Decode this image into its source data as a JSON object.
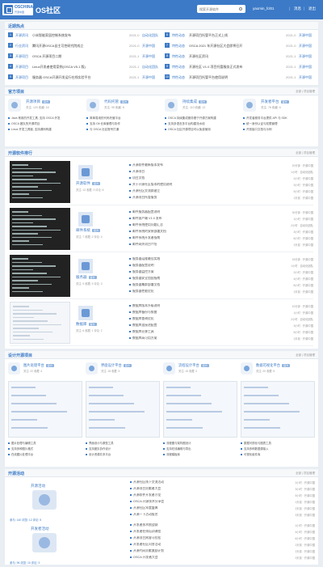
{
  "header": {
    "logo_top": "OSCHINA",
    "logo_sub": "开源中国",
    "site_title": "OS社区",
    "search_placeholder": "搜索开源软件",
    "user": "yaomin_fcl01",
    "link_msg": "消息",
    "link_logout": "退出",
    "sep": "|"
  },
  "news": {
    "title": "近期热点",
    "left": [
      {
        "n": "1",
        "cat": "开源资讯",
        "title": "小米智能家居控制系统发布",
        "date": "2021-0",
        "author": "自动化团队"
      },
      {
        "n": "2",
        "cat": "行业资讯",
        "title": "腾讯开源OSCA自主可控研究院成立",
        "date": "2021-0",
        "author": "开源中国"
      },
      {
        "n": "3",
        "cat": "开源项目",
        "title": "OSCA 开源项目二期",
        "date": "2021-1",
        "author": "开源中国"
      },
      {
        "n": "4",
        "cat": "开源项目",
        "title": "Linux开发者使用案例(OSCA V5.1 版)",
        "date": "2021-1",
        "author": "自动化团队"
      },
      {
        "n": "5",
        "cat": "开源项目",
        "title": "服务器 OSCA开源开发运行在线实验平台",
        "date": "2021-1",
        "author": "开源中国"
      }
    ],
    "right": [
      {
        "n": "6",
        "cat": "特性动态",
        "title": "开源项目托管平台正式上线",
        "date": "2021-0",
        "author": "开源中国"
      },
      {
        "n": "7",
        "cat": "特性动态",
        "title": "OSCA 2021 年开源社区大会即将召开",
        "date": "2021-0",
        "author": "开源中国"
      },
      {
        "n": "8",
        "cat": "特性动态",
        "title": "开源社区资讯",
        "date": "2021-1",
        "author": "开源中国"
      },
      {
        "n": "9",
        "cat": "特性动态",
        "title": "开源社区 V1.0 项目托管服务正式发布",
        "date": "2021-1",
        "author": "开源中国"
      },
      {
        "n": "10",
        "cat": "特性动态",
        "title": "开源项目托管平台使用说明",
        "date": "2021-1",
        "author": "开源中国"
      }
    ]
  },
  "projects": {
    "title": "官方项目",
    "right_text": "全部 | 项目管理",
    "items": [
      {
        "name": "开源项目",
        "badge": "官方",
        "stats": "关注: 120   收藏: 16",
        "notes": [
          "Java 常用的开发工具, 支持 OSCA 开发",
          "OSCA 团队的开源项目",
          "Linux 开发工具链, 支持源码构建"
        ]
      },
      {
        "name": "代码托管",
        "badge": "官方",
        "stats": "关注: 95   收藏: 8",
        "notes": [
          "简单易用的代码托管平台",
          "支持 Git 仓库管理与协作",
          "与 OSCA 社区账号打通"
        ]
      },
      {
        "name": "持续集成",
        "badge": "官方",
        "stats": "关注: 110   收藏: 12",
        "notes": [
          "OSCA 持续集成服务基于开源方案构建",
          "支持多语言多平台构建流水线",
          "OSCA 社区开源项目可以免费使用"
        ]
      },
      {
        "name": "开发者平台",
        "badge": "官方",
        "stats": "关注: 78   收藏: 6",
        "notes": [
          "开发者服务平台提供 API 与 SDK",
          "统一身份认证与权限管理",
          "开放接口文档与示例"
        ]
      }
    ]
  },
  "hot": {
    "title": "开源软件排行",
    "right_text": "全部 | 项目管理",
    "rows": [
      {
        "name": "开源软件",
        "badge": "官方",
        "stats": "关注: 12  收藏: 3  评论: 6",
        "topics": [
          [
            "开源软件最新版本发布",
            "20分钟 · 开源中国"
          ],
          [
            "开源项目",
            "1小时 · 自动化团队"
          ],
          [
            "项目文档",
            "2小时 · 开源中国"
          ],
          [
            "关于开源社区版本的使用说明",
            "3小时 · 开源中国"
          ],
          [
            "开源社区交流群建立",
            "5小时 · 开源中国"
          ],
          [
            "开源项目托管服务",
            "1天前 · 开源中国"
          ]
        ]
      },
      {
        "name": "邮件系统",
        "badge": "官方",
        "stats": "关注: 7  收藏: 2  评论: 4",
        "topics": [
          [
            "邮件服务器配置说明",
            "30分钟 · 开源中国"
          ],
          [
            "邮件客户端 V1.0 发布",
            "1小时 · 开源中国"
          ],
          [
            "邮件系统使用问题汇总",
            "2小时 · 自动化团队"
          ],
          [
            "邮件系统的安装部署文档",
            "3小时 · 开源中国"
          ],
          [
            "邮件系统开发者指南",
            "6小时 · 开源中国"
          ],
          [
            "邮件网关项目介绍",
            "1天前 · 开源中国"
          ]
        ]
      },
      {
        "name": "服务器",
        "badge": "官方",
        "stats": "关注: 9  收藏: 5  评论: 3",
        "topics": [
          [
            "服务器运维最佳实践",
            "15分钟 · 开源中国"
          ],
          [
            "服务器配置说明",
            "1小时 · 自动化团队"
          ],
          [
            "服务器监控方案",
            "2小时 · 开源中国"
          ],
          [
            "服务器安全加固指南",
            "4小时 · 开源中国"
          ],
          [
            "服务器集群部署文档",
            "8小时 · 开源中国"
          ],
          [
            "服务器性能优化",
            "1天前 · 开源中国"
          ]
        ]
      },
      {
        "name": "数据库",
        "badge": "官方",
        "stats": "关注: 6  收藏: 1  评论: 2",
        "topics": [
          [
            "数据库版本升级说明",
            "10分钟 · 开源中国"
          ],
          [
            "数据库备份与恢复",
            "1小时 · 开源中国"
          ],
          [
            "数据库查询优化",
            "2小时 · 自动化团队"
          ],
          [
            "数据库连接池配置",
            "3小时 · 开源中国"
          ],
          [
            "数据库迁移工具",
            "5小时 · 开源中国"
          ],
          [
            "数据库高可用方案",
            "1天前 · 开源中国"
          ]
        ]
      }
    ]
  },
  "design": {
    "title": "设计开源项目",
    "right_text": "全部 | 项目管理",
    "cards": [
      {
        "name": "图片处理平台",
        "badge": "官方",
        "stats": "关注: 22  收藏: 4",
        "notes": [
          "图片处理与编辑工具",
          "支持多种图片格式",
          "在线图片处理平台"
        ]
      },
      {
        "name": "界面设计平台",
        "badge": "官方",
        "stats": "关注: 18  收藏: 3",
        "notes": [
          "界面设计与原型工具",
          "支持团队协作设计",
          "设计资源共享平台"
        ]
      },
      {
        "name": "流程设计平台",
        "badge": "官方",
        "stats": "关注: 15  收藏: 2",
        "notes": [
          "流程图与架构图设计",
          "支持在线编辑与导出",
          "流程模板库"
        ]
      },
      {
        "name": "数据可视化平台",
        "badge": "官方",
        "stats": "关注: 20  收藏: 5",
        "notes": [
          "数据可视化与图表工具",
          "支持多种数据源接入",
          "可视化组件库"
        ]
      }
    ]
  },
  "events": {
    "title": "开源活动",
    "right_text": "全部 | 项目管理",
    "cards": [
      {
        "name": "开源活动",
        "stats": "参与: 140  浏览: 12  评论: 5",
        "topics": [
          [
            "开源社区线下交流活动",
            "2小时 · 开源中国"
          ],
          [
            "开源项目贡献者大会",
            "3小时 · 开源中国"
          ],
          [
            "开源软件开发者沙龙",
            "5小时 · 开源中国"
          ],
          [
            "OSCA 开源技术分享会",
            "1天前 · 开源中国"
          ],
          [
            "开源社区年度盛典",
            "2天前 · 开源中国"
          ],
          [
            "开源一下活动报名",
            "3天前 · 开源中国"
          ]
        ]
      },
      {
        "name": "开发者活动",
        "stats": "参与: 96  浏览: 10  评论: 3",
        "topics": [
          [
            "开发者技术挑战赛",
            "1小时 · 开源中国"
          ],
          [
            "开发者在线培训课程",
            "4小时 · 开源中国"
          ],
          [
            "开源项目黑客马拉松",
            "6小时 · 开源中国"
          ],
          [
            "开发者社区问答活动",
            "1天前 · 开源中国"
          ],
          [
            "开源代码贡献激励计划",
            "2天前 · 开源中国"
          ],
          [
            "OSCA 开发者大会",
            "3天前 · 开源中国"
          ]
        ]
      }
    ]
  }
}
